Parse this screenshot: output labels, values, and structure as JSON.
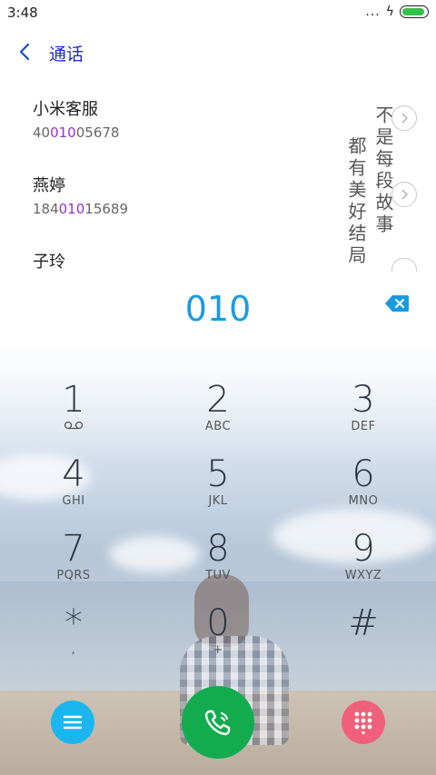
{
  "status_bar": {
    "time": "3:48",
    "more": "...",
    "battery_color": "#35c04a"
  },
  "header": {
    "title": "通话",
    "back_icon": "chevron-left-icon"
  },
  "contacts": [
    {
      "name": "小米客服",
      "number_pre": "40",
      "number_hl": "010",
      "number_post": "05678"
    },
    {
      "name": "燕婷",
      "number_pre": "184",
      "number_hl": "010",
      "number_post": "15689"
    },
    {
      "name": "子玲"
    }
  ],
  "poem": {
    "col1": "不是每段故事",
    "col2": "都有美好结局"
  },
  "dial": {
    "digits": "010",
    "digits_color": "#1a9be0",
    "highlight_color": "#9b2ed1"
  },
  "keypad": [
    {
      "digit": "1",
      "sub": "voicemail-icon"
    },
    {
      "digit": "2",
      "sub": "ABC"
    },
    {
      "digit": "3",
      "sub": "DEF"
    },
    {
      "digit": "4",
      "sub": "GHI"
    },
    {
      "digit": "5",
      "sub": "JKL"
    },
    {
      "digit": "6",
      "sub": "MNO"
    },
    {
      "digit": "7",
      "sub": "PQRS"
    },
    {
      "digit": "8",
      "sub": "TUV"
    },
    {
      "digit": "9",
      "sub": "WXYZ"
    },
    {
      "digit": "*",
      "sub": ","
    },
    {
      "digit": "0",
      "sub": "+"
    },
    {
      "digit": "#",
      "sub": ""
    }
  ],
  "bottom": {
    "menu_color": "#1ab6ef",
    "call_color": "#12ac4f",
    "keypad_color": "#f0607a"
  }
}
